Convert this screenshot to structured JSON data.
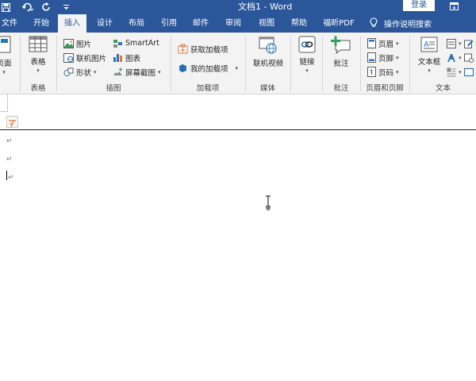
{
  "titlebar": {
    "document_title": "文档1 - Word",
    "login_label": "登录"
  },
  "quick_access": {
    "icons": [
      "save-icon",
      "undo-icon",
      "redo-icon",
      "customize-icon"
    ]
  },
  "tabs": [
    {
      "label": "文件",
      "active": false
    },
    {
      "label": "开始",
      "active": false
    },
    {
      "label": "插入",
      "active": true
    },
    {
      "label": "设计",
      "active": false
    },
    {
      "label": "布局",
      "active": false
    },
    {
      "label": "引用",
      "active": false
    },
    {
      "label": "邮件",
      "active": false
    },
    {
      "label": "审阅",
      "active": false
    },
    {
      "label": "视图",
      "active": false
    },
    {
      "label": "帮助",
      "active": false
    },
    {
      "label": "福昕PDF",
      "active": false
    }
  ],
  "tell_me": {
    "label": "操作说明搜索"
  },
  "ribbon": {
    "pages_group": {
      "button_label": "页面"
    },
    "tables_group": {
      "label": "表格",
      "button_label": "表格"
    },
    "illustrations_group": {
      "label": "插图",
      "pictures": "图片",
      "online_pictures": "联机图片",
      "shapes": "形状",
      "smartart": "SmartArt",
      "chart": "图表",
      "screenshot": "屏幕截图"
    },
    "addins_group": {
      "label": "加载项",
      "get_addins": "获取加载项",
      "my_addins": "我的加载项"
    },
    "media_group": {
      "label": "媒体",
      "online_video": "联机视频"
    },
    "links_group": {
      "button_label": "链接"
    },
    "comments_group": {
      "label": "批注",
      "comment": "批注"
    },
    "header_footer_group": {
      "label": "页眉和页脚",
      "header": "页眉",
      "footer": "页脚",
      "page_number": "页码"
    },
    "text_group": {
      "label": "文本",
      "textbox": "文本框"
    }
  },
  "colors": {
    "word_blue": "#2b579a",
    "ribbon_bg": "#f3f3f3",
    "icon_blue": "#2e75b6",
    "icon_green": "#3a9d5d",
    "icon_orange": "#e07b39"
  }
}
